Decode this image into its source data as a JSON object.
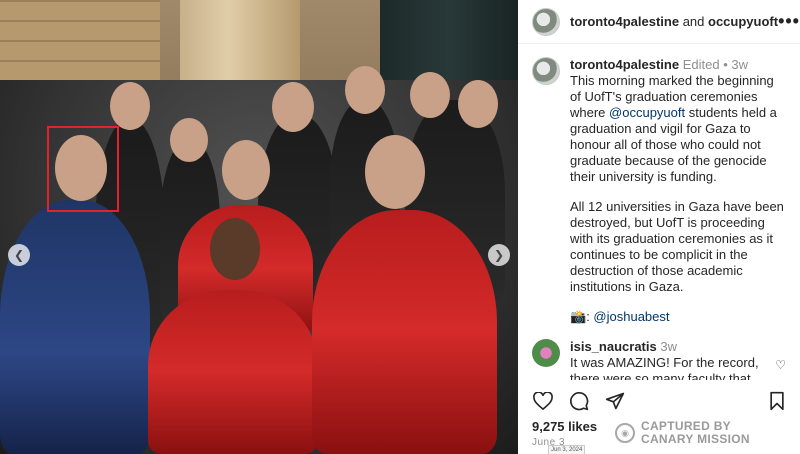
{
  "header": {
    "username": "toronto4palestine",
    "and_text": " and ",
    "collab_username": "occupyuoft"
  },
  "post": {
    "username": "toronto4palestine",
    "edited": "Edited",
    "dot": "•",
    "age": "3w",
    "para1_before": "This morning marked the beginning of UofT's graduation ceremonies where ",
    "para1_mention": "@occupyuoft",
    "para1_after": " students held a graduation and vigil for Gaza to honour all of those who could not graduate because of the genocide their university is funding.",
    "para2": "All 12 universities in Gaza have been destroyed, but UofT is proceeding with its graduation ceremonies as it continues to be complicit in the destruction of those academic institutions in Gaza.",
    "camera_emoji": "📸",
    "credit_sep": ": ",
    "credit_mention": "@joshuabest"
  },
  "reply": {
    "username": "isis_naucratis",
    "age": "3w",
    "text": "It was AMAZING! For the record, there were so many faculty that LOADS of us who were at the back"
  },
  "stats": {
    "likes": "9,275 likes",
    "date": "June 3",
    "date_tooltip": "Jun 3, 2024"
  },
  "watermark": {
    "line1": "CAPTURED BY",
    "line2": "CANARY MISSION"
  },
  "icons": {
    "heart": "heart-icon",
    "comment": "comment-icon",
    "share": "share-icon",
    "bookmark": "bookmark-icon",
    "more": "more-icon"
  },
  "colors": {
    "highlight_box": "#e3232b",
    "link": "#00376b",
    "meta": "#8e8e8e"
  }
}
